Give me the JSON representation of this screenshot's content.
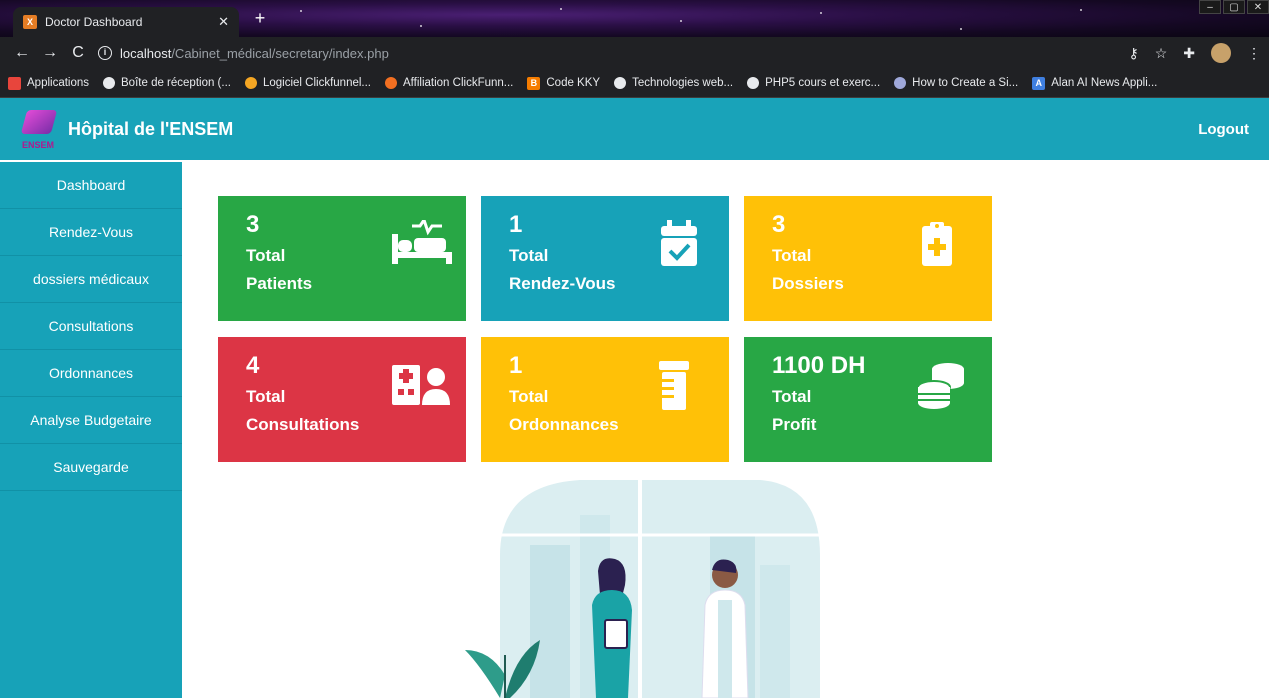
{
  "browser": {
    "tab_title": "Doctor Dashboard",
    "url_host": "localhost",
    "url_path": "/Cabinet_médical/secretary/index.php",
    "bookmarks": [
      "Applications",
      "Boîte de réception (...",
      "Logiciel Clickfunnel...",
      "Affiliation ClickFunn...",
      "Code KKY",
      "Technologies web...",
      "PHP5 cours et exerc...",
      "How to Create a Si...",
      "Alan AI News Appli..."
    ]
  },
  "header": {
    "logo_text": "ENSEM",
    "title": "Hôpital de l'ENSEM",
    "logout": "Logout"
  },
  "sidebar": {
    "items": [
      "Dashboard",
      "Rendez-Vous",
      "dossiers médicaux",
      "Consultations",
      "Ordonnances",
      "Analyse Budgetaire",
      "Sauvegarde"
    ]
  },
  "cards": [
    {
      "value": "3",
      "line1": "Total",
      "line2": "Patients",
      "color": "#28a745",
      "icon": "bed-pulse-icon"
    },
    {
      "value": "1",
      "line1": "Total",
      "line2": "Rendez-Vous",
      "color": "#17a2b8",
      "icon": "calendar-check-icon"
    },
    {
      "value": "3",
      "line1": "Total",
      "line2": "Dossiers",
      "color": "#ffc107",
      "icon": "clipboard-medical-icon"
    },
    {
      "value": "4",
      "line1": "Total",
      "line2": "Consultations",
      "color": "#dc3545",
      "icon": "hospital-user-icon"
    },
    {
      "value": "1",
      "line1": "Total",
      "line2": "Ordonnances",
      "color": "#ffc107",
      "icon": "prescription-bottle-icon"
    },
    {
      "value": "1100 DH",
      "line1": "Total",
      "line2": "Profit",
      "color": "#28a745",
      "icon": "coins-icon"
    }
  ]
}
